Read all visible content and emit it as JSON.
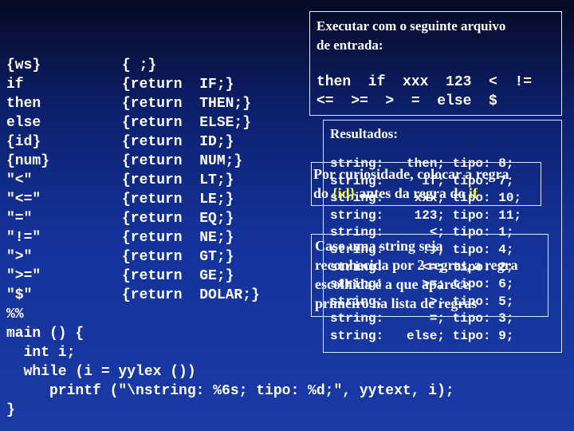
{
  "rules": [
    {
      "pattern": "{ws}",
      "action": "{ ;}"
    },
    {
      "pattern": "if",
      "action": "{return  IF;}"
    },
    {
      "pattern": "then",
      "action": "{return  THEN;}"
    },
    {
      "pattern": "else",
      "action": "{return  ELSE;}"
    },
    {
      "pattern": "{id}",
      "action": "{return  ID;}"
    },
    {
      "pattern": "{num}",
      "action": "{return  NUM;}"
    },
    {
      "pattern": "\"<\"",
      "action": "{return  LT;}"
    },
    {
      "pattern": "\"<=\"",
      "action": "{return  LE;}"
    },
    {
      "pattern": "\"=\"",
      "action": "{return  EQ;}"
    },
    {
      "pattern": "\"!=\"",
      "action": "{return  NE;}"
    },
    {
      "pattern": "\">\"",
      "action": "{return  GT;}"
    },
    {
      "pattern": "\">=\"",
      "action": "{return  GE;}"
    },
    {
      "pattern": "\"$\"",
      "action": "{return  DOLAR;}"
    }
  ],
  "code": [
    "%%",
    "main () {",
    "  int i;",
    "  while (i = yylex ())",
    "     printf (\"\\nstring: %6s; tipo: %d;\", yytext, i);",
    "}"
  ],
  "input_box": {
    "title_line1": "Executar com o seguinte arquivo",
    "title_line2": "de entrada:",
    "input_line1": "then  if  xxx  123  <  !=",
    "input_line2": "<=  >=  >  =  else  $"
  },
  "results": {
    "title": "Resultados:",
    "lines": [
      "string:   then; tipo: 8;",
      "string:     if; tipo: 7;",
      "string:    xxx; tipo: 10;",
      "string:    123; tipo: 11;",
      "string:      <; tipo: 1;",
      "string:     !=; tipo: 4;",
      "string:     <=; tipo: 2;",
      "string:     >=; tipo: 6;",
      "string:      >; tipo: 5;",
      "string:      =; tipo: 3;",
      "string:   else; tipo: 9;"
    ]
  },
  "note1": {
    "a": "Por curiosidade, colocar a regra",
    "b": "do ",
    "c": "{id}",
    "d": " antes da regra do ",
    "e": "if"
  },
  "note2": {
    "l1": "Caso uma string seja",
    "l2": "reconhecida por 2 regras, a regra",
    "l3": "escolhida é a que aparece",
    "l4": "primeiro na lista de regras"
  },
  "colors": {
    "highlight": "#ffff33",
    "background": "#1a3aa6"
  }
}
